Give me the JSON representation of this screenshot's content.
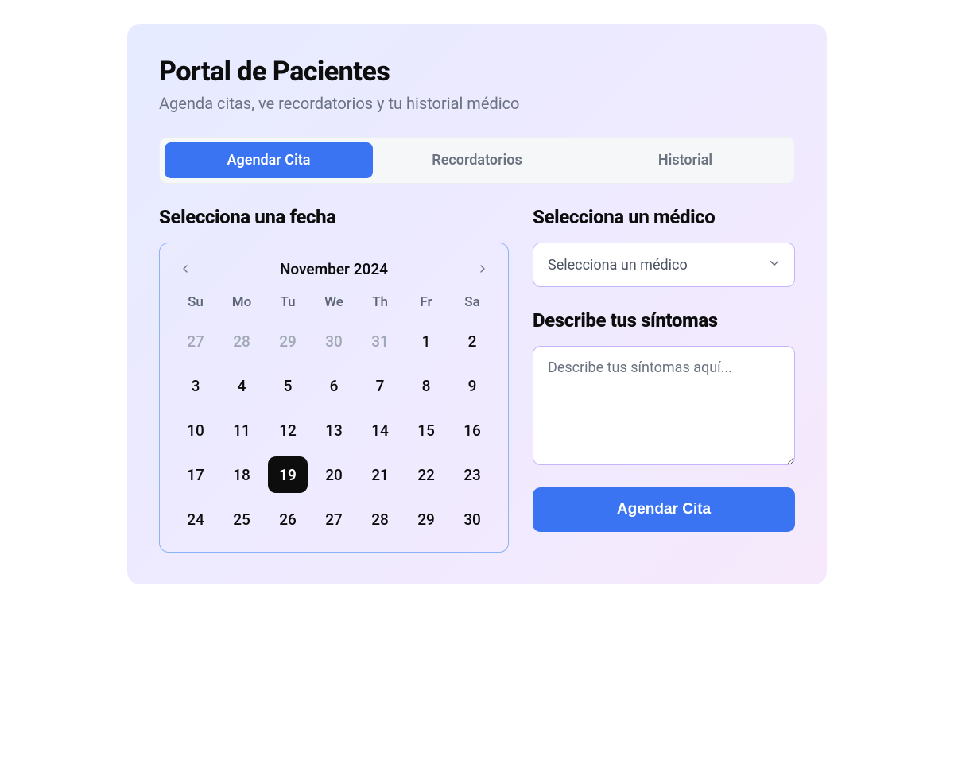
{
  "header": {
    "title": "Portal de Pacientes",
    "subtitle": "Agenda citas, ve recordatorios y tu historial médico"
  },
  "tabs": {
    "schedule": "Agendar Cita",
    "reminders": "Recordatorios",
    "history": "Historial"
  },
  "section": {
    "date_title": "Selecciona una fecha",
    "doctor_title": "Selecciona un médico",
    "symptoms_title": "Describe tus síntomas"
  },
  "calendar": {
    "month_label": "November 2024",
    "weekdays": [
      "Su",
      "Mo",
      "Tu",
      "We",
      "Th",
      "Fr",
      "Sa"
    ],
    "prev_days": [
      27,
      28,
      29,
      30,
      31
    ],
    "days": [
      1,
      2,
      3,
      4,
      5,
      6,
      7,
      8,
      9,
      10,
      11,
      12,
      13,
      14,
      15,
      16,
      17,
      18,
      19,
      20,
      21,
      22,
      23,
      24,
      25,
      26,
      27,
      28,
      29,
      30
    ],
    "today": 19
  },
  "doctor_select": {
    "placeholder": "Selecciona un médico"
  },
  "symptoms": {
    "placeholder": "Describe tus síntomas aquí..."
  },
  "actions": {
    "submit": "Agendar Cita"
  }
}
